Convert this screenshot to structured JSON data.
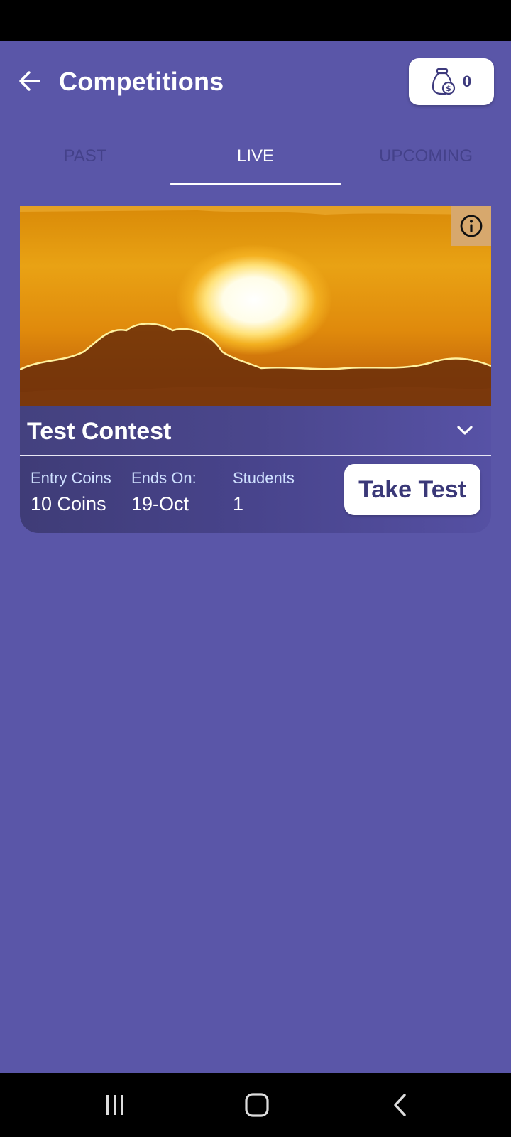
{
  "header": {
    "title": "Competitions",
    "coins": "0"
  },
  "tabs": [
    {
      "label": "PAST",
      "active": false
    },
    {
      "label": "LIVE",
      "active": true
    },
    {
      "label": "UPCOMING",
      "active": false
    }
  ],
  "contest": {
    "name": "Test Contest",
    "stats": [
      {
        "label": "Entry Coins",
        "value": "10 Coins"
      },
      {
        "label": "Ends On:",
        "value": "19-Oct"
      },
      {
        "label": "Students",
        "value": "1"
      }
    ],
    "action_label": "Take Test"
  },
  "colors": {
    "background": "#5a56a8",
    "accent_text": "#3d3a7d",
    "tab_inactive": "#44418a",
    "info_button_bg": "#d7a86d"
  },
  "icons": {
    "back": "arrow-left-icon",
    "coins": "money-bag-icon",
    "info": "info-icon",
    "expand": "chevron-down-icon",
    "nav_recents": "recents-icon",
    "nav_home": "home-icon",
    "nav_back": "nav-back-icon"
  }
}
